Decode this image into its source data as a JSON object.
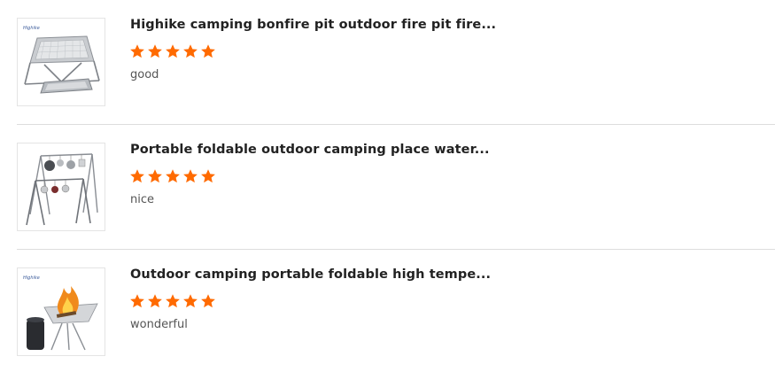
{
  "colors": {
    "star": "#ff6a00",
    "divider": "#dddddd",
    "title": "#222222",
    "comment": "#555555"
  },
  "reviews": [
    {
      "image_icon": "fire-pit-product-image",
      "title": "Highike camping bonfire pit outdoor fire pit fire...",
      "rating": 5,
      "rating_max": 5,
      "comment": "good"
    },
    {
      "image_icon": "hanging-rack-product-image",
      "title": "Portable foldable outdoor camping place water...",
      "rating": 5,
      "rating_max": 5,
      "comment": "nice"
    },
    {
      "image_icon": "fire-stand-product-image",
      "title": "Outdoor camping portable foldable high tempe...",
      "rating": 5,
      "rating_max": 5,
      "comment": "wonderful"
    }
  ]
}
